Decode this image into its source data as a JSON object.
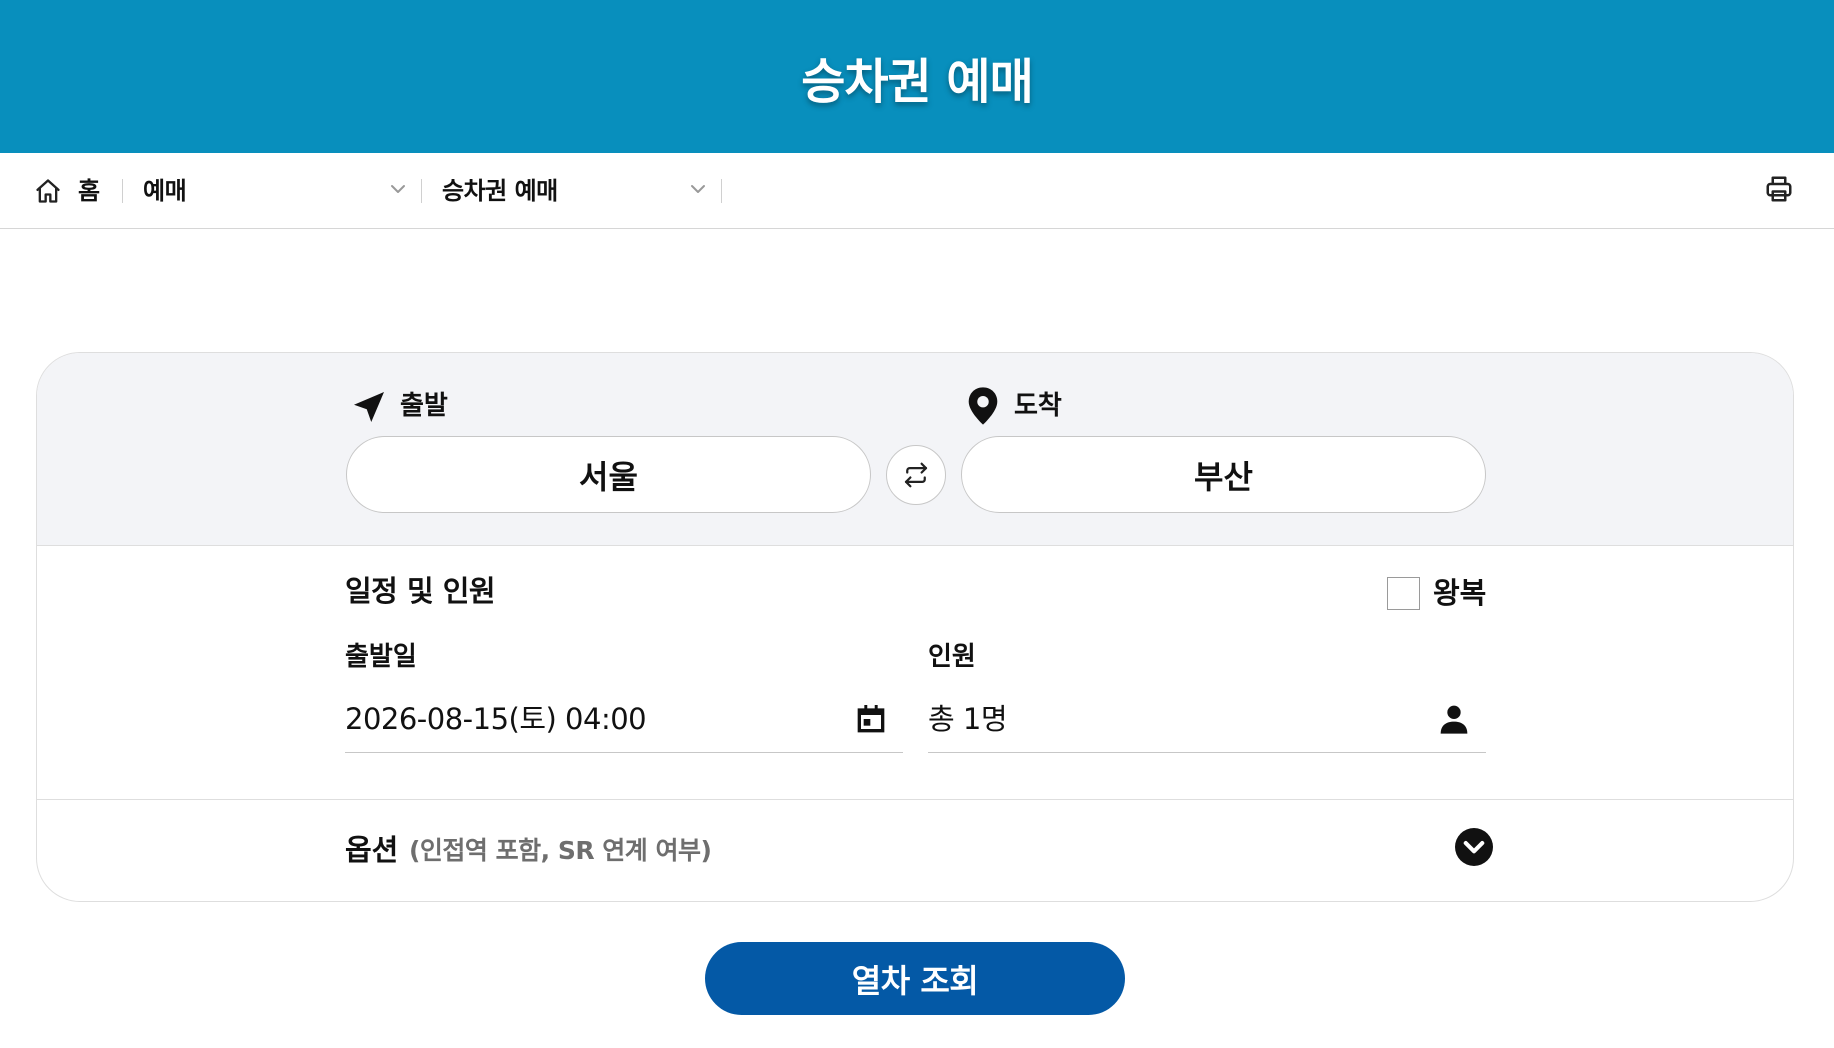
{
  "header": {
    "title": "승차권 예매"
  },
  "breadcrumb": {
    "home_label": "홈",
    "level1": "예매",
    "level2": "승차권 예매"
  },
  "route": {
    "departure_label": "출발",
    "arrival_label": "도착",
    "departure_station": "서울",
    "arrival_station": "부산"
  },
  "schedule": {
    "section_title": "일정 및 인원",
    "roundtrip_label": "왕복",
    "roundtrip_checked": false,
    "date_label": "출발일",
    "date_value": "2026-08-15(토) 04:00",
    "passenger_label": "인원",
    "passenger_value": "총 1명"
  },
  "options": {
    "title": "옵션",
    "subtitle": "(인접역 포함, SR 연계 여부)"
  },
  "search_button": {
    "label": "열차 조회"
  },
  "colors": {
    "header_bg": "#088fbd",
    "primary_button": "#0459a6",
    "panel_bg": "#f3f4f7"
  }
}
